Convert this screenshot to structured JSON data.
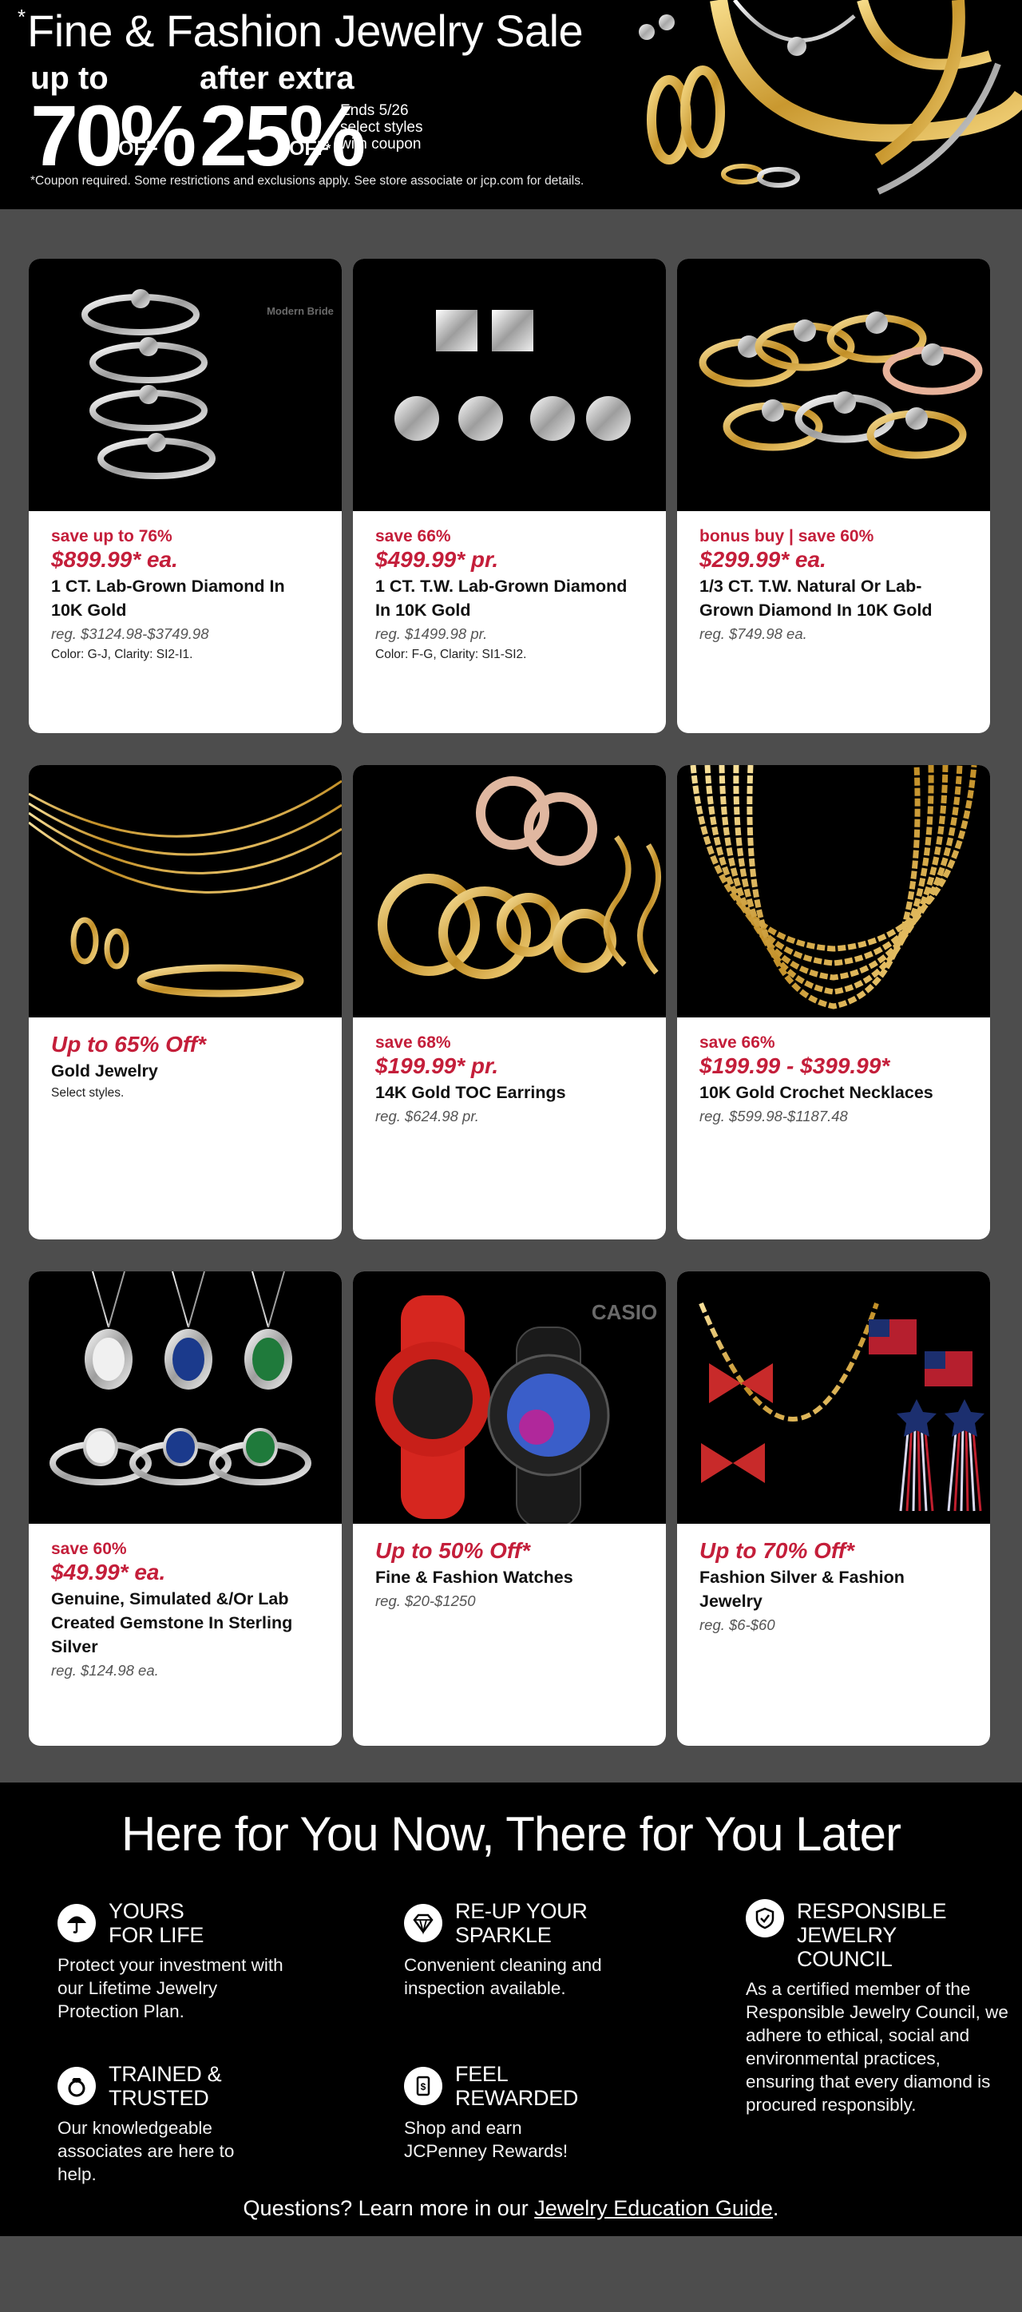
{
  "banner": {
    "asterisk": "*",
    "headline": "Fine & Fashion Jewelry Sale",
    "offer1": {
      "lead": "up to",
      "value": "70%",
      "off": "OFF"
    },
    "offer2": {
      "lead": "after extra",
      "value": "25%",
      "off": "OFF",
      "sup": "*",
      "ends": [
        "Ends 5/26",
        "select styles",
        "with coupon"
      ]
    },
    "disclaimer": "*Coupon required. Some restrictions and exclusions apply. See store associate or jcp.com for details."
  },
  "products": [
    {
      "promo": "save up to 76%",
      "price": "$899.99* ea.",
      "name": "1 CT. Lab-Grown Diamond In 10K Gold",
      "reg": "reg. $3124.98-$3749.98",
      "note": "Color: G-J, Clarity: SI2-I1.",
      "image": "ring-stack",
      "watermark": "Modern Bride"
    },
    {
      "promo": "save 66%",
      "price": "$499.99* pr.",
      "name": "1 CT. T.W. Lab-Grown Diamond In 10K Gold",
      "reg": "reg. $1499.98 pr.",
      "note": "Color: F-G, Clarity: SI1-SI2.",
      "image": "stud-earrings"
    },
    {
      "promo": "bonus buy | save 60%",
      "price": "$299.99* ea.",
      "name": "1/3 CT. T.W. Natural Or Lab-Grown Diamond In 10K Gold",
      "reg": "reg. $749.98 ea.",
      "note": "",
      "image": "cluster-rings"
    },
    {
      "promo": "Up to 65% Off*",
      "price": "",
      "name": "Gold Jewelry",
      "reg": "",
      "note": "Select styles.",
      "image": "gold-jewelry"
    },
    {
      "promo": "save 68%",
      "price": "$199.99* pr.",
      "name": "14K Gold TOC Earrings",
      "reg": "reg. $624.98 pr.",
      "note": "",
      "image": "hoop-earrings"
    },
    {
      "promo": "save 66%",
      "price": "$199.99 - $399.99*",
      "name": "10K Gold Crochet Necklaces",
      "reg": "reg. $599.98-$1187.48",
      "note": "",
      "image": "crochet-necklaces"
    },
    {
      "promo": "save 60%",
      "price": "$49.99* ea.",
      "name": "Genuine, Simulated &/Or Lab Created Gemstone In Sterling Silver",
      "reg": "reg. $124.98 ea.",
      "note": "",
      "image": "gemstones"
    },
    {
      "promo": "Up to 50% Off*",
      "price": "",
      "name": "Fine & Fashion Watches",
      "reg": "reg. $20-$1250",
      "note": "",
      "image": "watches",
      "watermark": "CASIO"
    },
    {
      "promo": "Up to 70% Off*",
      "price": "",
      "name": "Fashion Silver & Fashion Jewelry",
      "reg": "reg. $6-$60",
      "note": "",
      "image": "fashion-jewelry"
    }
  ],
  "services": {
    "title": "Here for You Now, There for You Later",
    "items": [
      {
        "title_lines": [
          "YOURS",
          "FOR LIFE"
        ],
        "desc": "Protect your investment with our Lifetime Jewelry Protection Plan.",
        "icon": "umbrella-icon"
      },
      {
        "title_lines": [
          "RE-UP YOUR",
          "SPARKLE"
        ],
        "desc": "Convenient cleaning  and inspection available.",
        "icon": "diamond-icon"
      },
      {
        "title_lines": [
          "RESPONSIBLE",
          "JEWELRY",
          "COUNCIL"
        ],
        "desc": "As a certified member of the Responsible Jewelry Council, we adhere to ethical, social and environmental practices, ensuring that every diamond is procured responsibly.",
        "icon": "shield-check-icon"
      },
      {
        "title_lines": [
          "TRAINED &",
          "TRUSTED"
        ],
        "desc": "Our knowledgeable associates are here to help.",
        "icon": "ring-icon"
      },
      {
        "title_lines": [
          "FEEL",
          "REWARDED"
        ],
        "desc": "Shop and earn JCPenney Rewards!",
        "icon": "rewards-card-icon"
      }
    ],
    "faq_prefix": "Questions? Learn more in our ",
    "faq_link": "Jewelry Education Guide",
    "faq_suffix": "."
  },
  "colors": {
    "accent": "#c41e3a",
    "page_bg": "#4d4d4d",
    "banner_bg": "#000000"
  }
}
